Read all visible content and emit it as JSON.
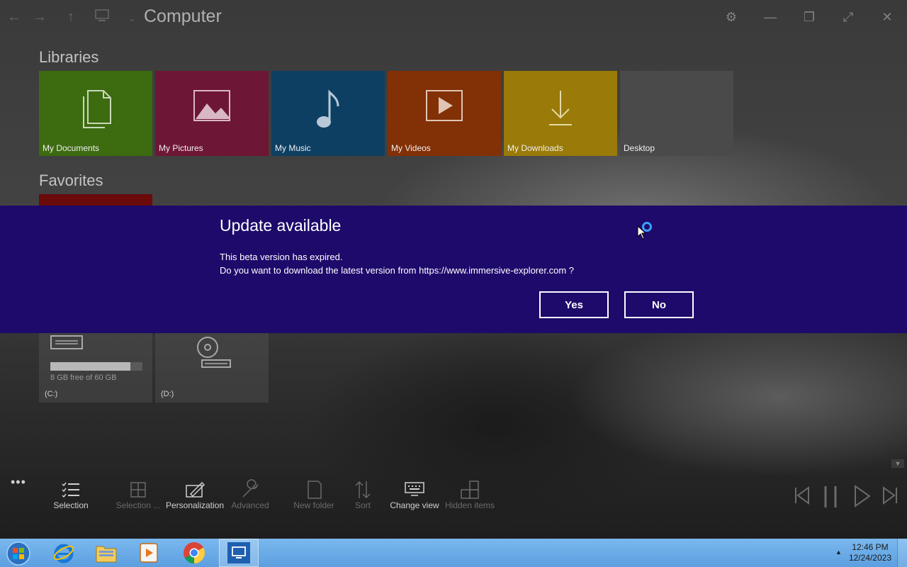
{
  "window": {
    "title": "Computer",
    "nav": [
      "back",
      "forward",
      "up"
    ]
  },
  "libraries": {
    "heading": "Libraries",
    "tiles": [
      {
        "label": "My Documents",
        "icon": "documents-icon",
        "color": "#3d6b10"
      },
      {
        "label": "My Pictures",
        "icon": "pictures-icon",
        "color": "#6e1636"
      },
      {
        "label": "My Music",
        "icon": "music-note-icon",
        "color": "#0d3f62"
      },
      {
        "label": "My Videos",
        "icon": "video-play-icon",
        "color": "#823006"
      },
      {
        "label": "My Downloads",
        "icon": "download-arrow-icon",
        "color": "#9a7a08"
      },
      {
        "label": "Desktop",
        "icon": "",
        "color": "#4a4a4a"
      }
    ]
  },
  "favorites": {
    "heading": "Favorites"
  },
  "drives": [
    {
      "label": "(C:)",
      "space": "8 GB free of 60 GB",
      "used_fraction": 0.87
    },
    {
      "label": "(D:)",
      "space": "",
      "used_fraction": null
    }
  ],
  "dialog": {
    "title": "Update available",
    "line1": "This beta version has expired.",
    "line2": "Do you want to download the latest version from https://www.immersive-explorer.com ?",
    "yes_label": "Yes",
    "no_label": "No",
    "background": "#1e0a6b"
  },
  "commands": [
    {
      "label": "Selection",
      "enabled": true,
      "icon": "checklist-icon"
    },
    {
      "label": "Selection ...",
      "enabled": false,
      "icon": "select-grid-icon"
    },
    {
      "label": "Personalization",
      "enabled": true,
      "icon": "paint-icon"
    },
    {
      "label": "Advanced",
      "enabled": false,
      "icon": "wrench-icon"
    },
    {
      "label": "New folder",
      "enabled": false,
      "icon": "new-folder-icon"
    },
    {
      "label": "Sort",
      "enabled": false,
      "icon": "sort-icon"
    },
    {
      "label": "Change view",
      "enabled": true,
      "icon": "keyboard-view-icon"
    },
    {
      "label": "Hidden items",
      "enabled": false,
      "icon": "hidden-items-icon"
    }
  ],
  "taskbar": {
    "time": "12:46 PM",
    "date": "12/24/2023",
    "apps": [
      "start-orb",
      "internet-explorer",
      "file-explorer",
      "media-player",
      "chrome",
      "immersive-explorer"
    ]
  }
}
